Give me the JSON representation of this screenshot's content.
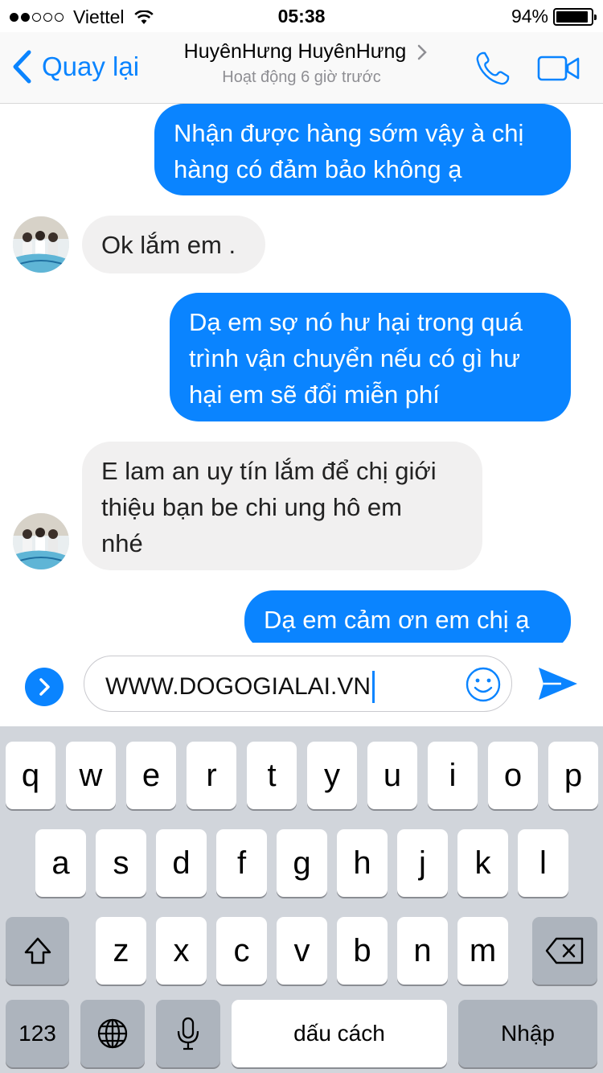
{
  "status_bar": {
    "carrier": "Viettel",
    "time": "05:38",
    "battery": "94%",
    "battery_level": 0.94,
    "signal_bars": 2
  },
  "nav": {
    "back_label": "Quay lại",
    "title": "HuyênHưng HuyênHưng",
    "subtitle": "Hoạt động 6 giờ trước",
    "call_icon": "phone-icon",
    "video_icon": "video-camera-icon"
  },
  "messages": [
    {
      "direction": "out",
      "lines": [
        "Nhận được hàng sớm vậy à chị",
        "hàng có đảm bảo không ạ"
      ]
    },
    {
      "direction": "in",
      "lines": [
        "Ok lắm em ."
      ]
    },
    {
      "direction": "out",
      "lines": [
        "Dạ em sợ nó hư hại trong quá",
        "trình vận chuyển nếu có gì hư",
        "hại em sẽ đổi miễn phí"
      ]
    },
    {
      "direction": "in",
      "lines": [
        "E lam an uy tín lắm để chị giới",
        "thiệu bạn be chi ung hô em",
        "nhé"
      ]
    },
    {
      "direction": "out",
      "lines": [
        "Dạ em cảm ơn em chị ạ"
      ]
    }
  ],
  "composer": {
    "input_value": "WWW.DOGOGIALAI.VN",
    "expand_icon": "chevron-right-icon",
    "emoji_icon": "smiley-icon",
    "send_icon": "send-icon"
  },
  "keyboard": {
    "row1": [
      "q",
      "w",
      "e",
      "r",
      "t",
      "y",
      "u",
      "i",
      "o",
      "p"
    ],
    "row2": [
      "a",
      "s",
      "d",
      "f",
      "g",
      "h",
      "j",
      "k",
      "l"
    ],
    "row3": [
      "z",
      "x",
      "c",
      "v",
      "b",
      "n",
      "m"
    ],
    "numbers_label": "123",
    "space_label": "dấu cách",
    "return_label": "Nhập",
    "shift_icon": "shift-icon",
    "delete_icon": "backspace-icon",
    "globe_icon": "globe-icon",
    "mic_icon": "microphone-icon"
  },
  "colors": {
    "accent": "#0a84ff",
    "incoming_bubble": "#f1f0f0",
    "keyboard_bg": "#d1d5db"
  }
}
